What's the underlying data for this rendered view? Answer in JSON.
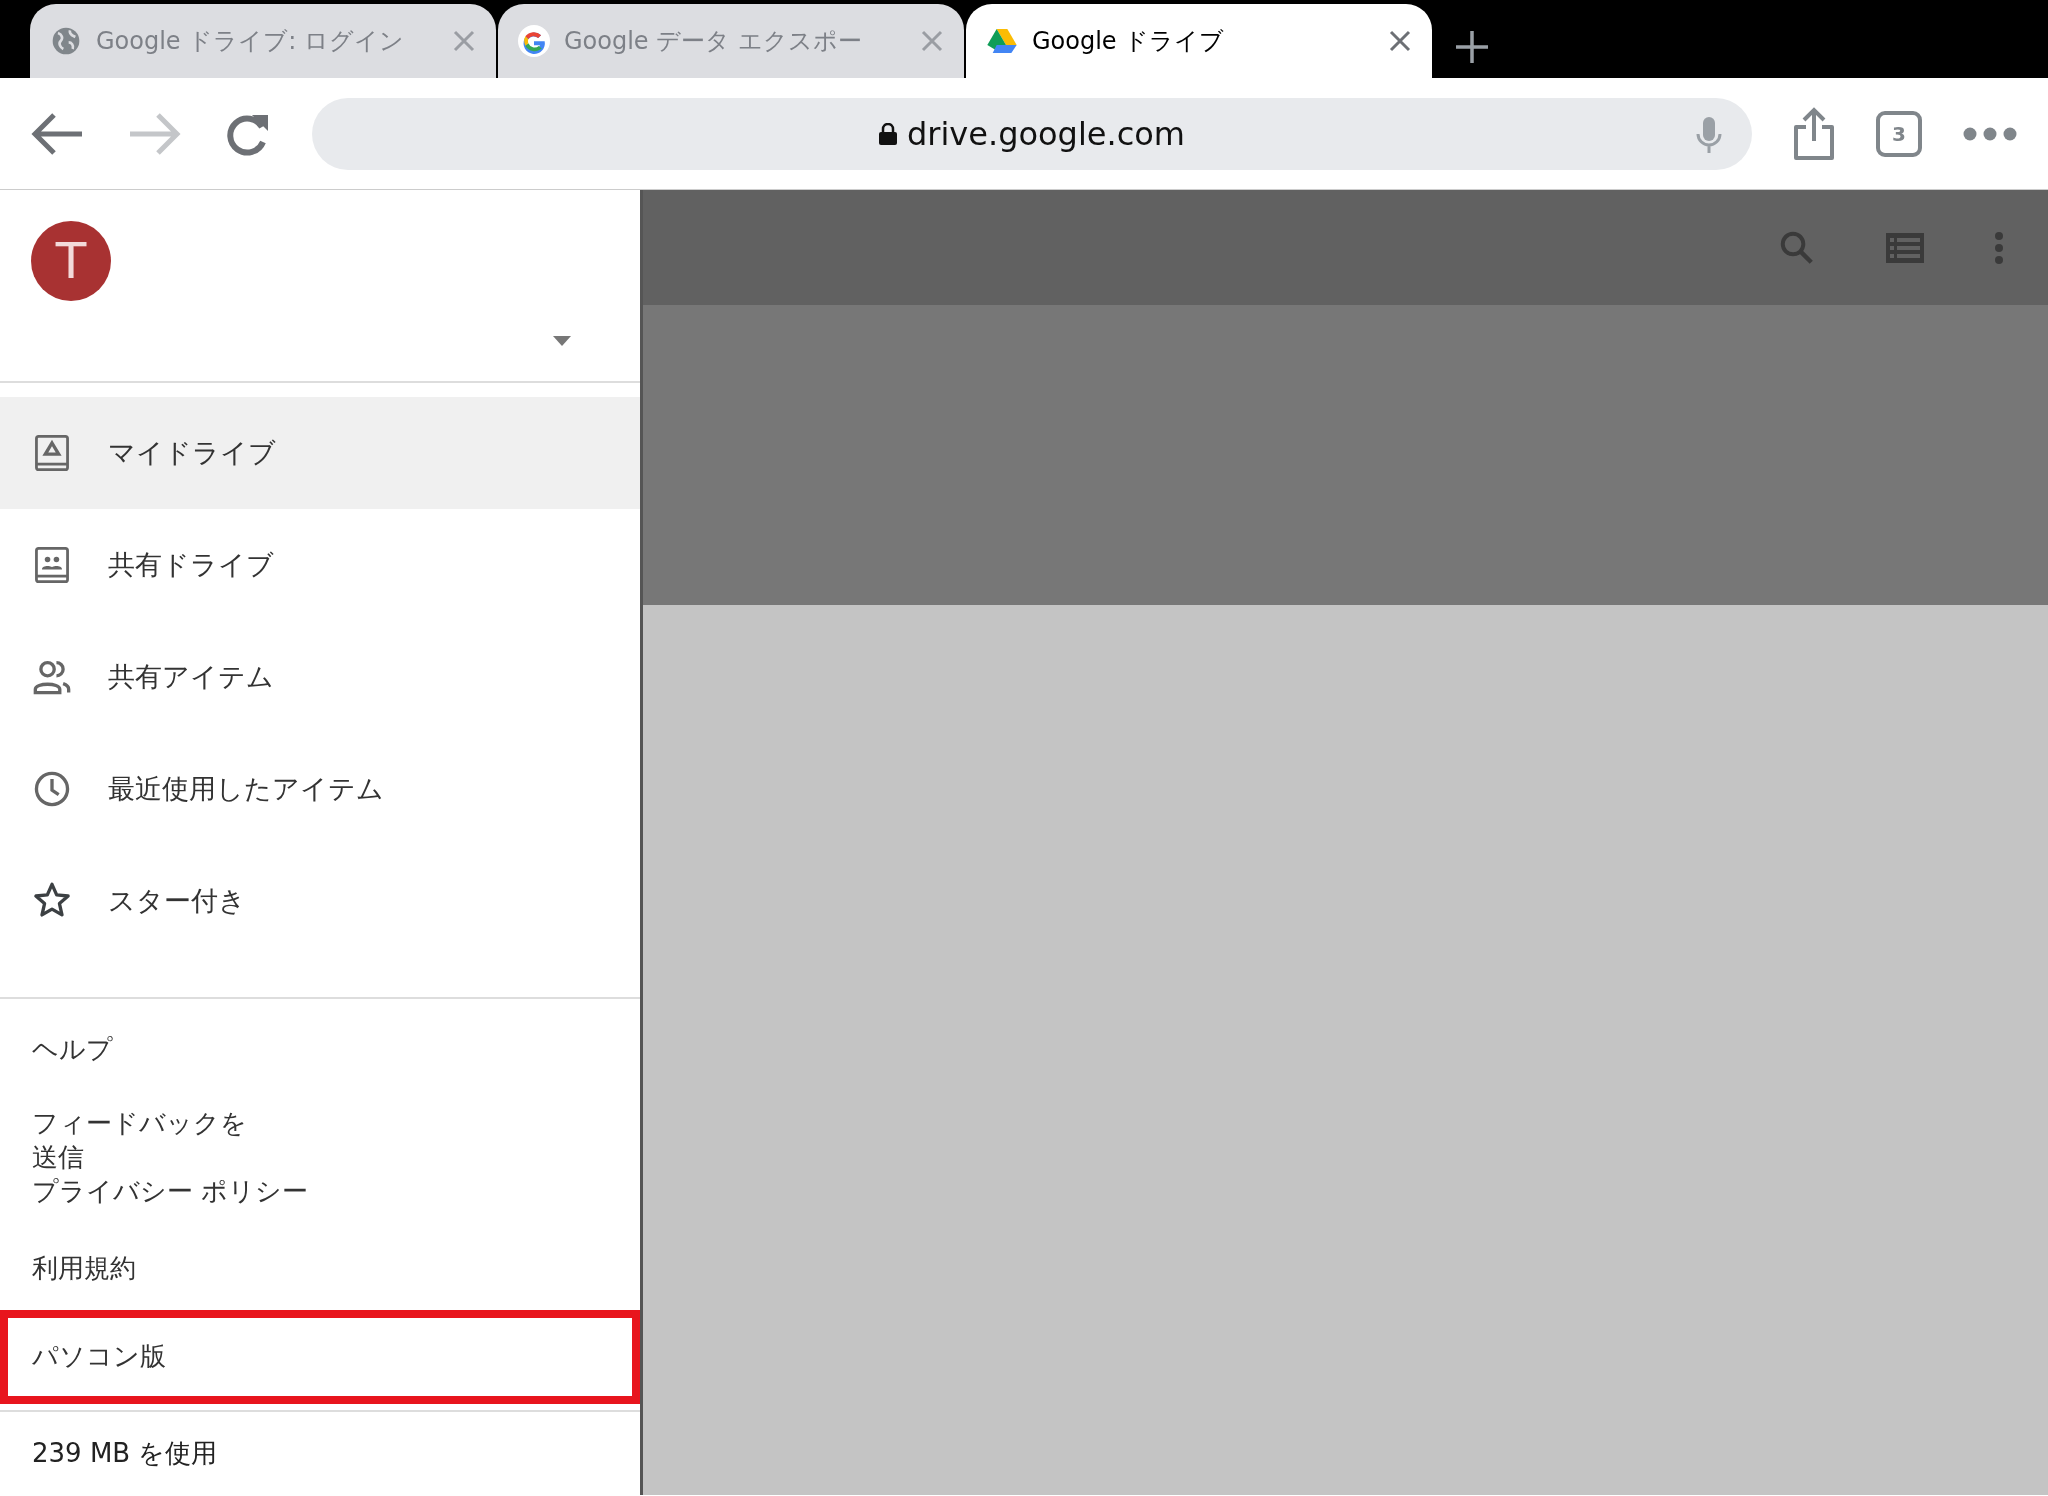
{
  "tabs": [
    {
      "title": "Google ドライブ: ログイン",
      "selected": false
    },
    {
      "title": "Google データ エクスポー",
      "selected": false
    },
    {
      "title": "Google ドライブ",
      "selected": true
    }
  ],
  "toolbar": {
    "url": "drive.google.com",
    "tab_count": "3",
    "forward_disabled": true
  },
  "account": {
    "initial": "T"
  },
  "drawer_items": [
    {
      "label": "マイドライブ",
      "selected": true
    },
    {
      "label": "共有ドライブ",
      "selected": false
    },
    {
      "label": "共有アイテム",
      "selected": false
    },
    {
      "label": "最近使用したアイテム",
      "selected": false
    },
    {
      "label": "スター付き",
      "selected": false
    }
  ],
  "footer_links": [
    {
      "label": "ヘルプ",
      "highlighted": false
    },
    {
      "label": "フィードバックを送信",
      "highlighted": false
    },
    {
      "label": "プライバシー ポリシー",
      "highlighted": false
    },
    {
      "label": "利用規約",
      "highlighted": false
    },
    {
      "label": "パソコン版",
      "highlighted": true
    }
  ],
  "storage": "239 MB を使用"
}
